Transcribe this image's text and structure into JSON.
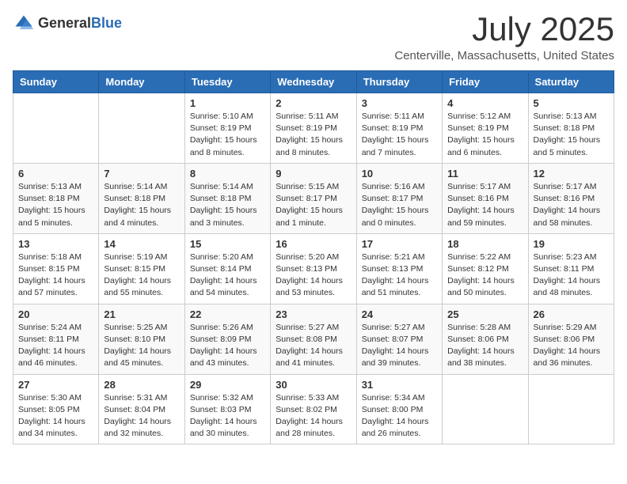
{
  "header": {
    "logo_general": "General",
    "logo_blue": "Blue",
    "month": "July 2025",
    "location": "Centerville, Massachusetts, United States"
  },
  "weekdays": [
    "Sunday",
    "Monday",
    "Tuesday",
    "Wednesday",
    "Thursday",
    "Friday",
    "Saturday"
  ],
  "weeks": [
    [
      null,
      null,
      {
        "day": 1,
        "sunrise": "5:10 AM",
        "sunset": "8:19 PM",
        "daylight": "15 hours and 8 minutes."
      },
      {
        "day": 2,
        "sunrise": "5:11 AM",
        "sunset": "8:19 PM",
        "daylight": "15 hours and 8 minutes."
      },
      {
        "day": 3,
        "sunrise": "5:11 AM",
        "sunset": "8:19 PM",
        "daylight": "15 hours and 7 minutes."
      },
      {
        "day": 4,
        "sunrise": "5:12 AM",
        "sunset": "8:19 PM",
        "daylight": "15 hours and 6 minutes."
      },
      {
        "day": 5,
        "sunrise": "5:13 AM",
        "sunset": "8:18 PM",
        "daylight": "15 hours and 5 minutes."
      }
    ],
    [
      {
        "day": 6,
        "sunrise": "5:13 AM",
        "sunset": "8:18 PM",
        "daylight": "15 hours and 5 minutes."
      },
      {
        "day": 7,
        "sunrise": "5:14 AM",
        "sunset": "8:18 PM",
        "daylight": "15 hours and 4 minutes."
      },
      {
        "day": 8,
        "sunrise": "5:14 AM",
        "sunset": "8:18 PM",
        "daylight": "15 hours and 3 minutes."
      },
      {
        "day": 9,
        "sunrise": "5:15 AM",
        "sunset": "8:17 PM",
        "daylight": "15 hours and 1 minute."
      },
      {
        "day": 10,
        "sunrise": "5:16 AM",
        "sunset": "8:17 PM",
        "daylight": "15 hours and 0 minutes."
      },
      {
        "day": 11,
        "sunrise": "5:17 AM",
        "sunset": "8:16 PM",
        "daylight": "14 hours and 59 minutes."
      },
      {
        "day": 12,
        "sunrise": "5:17 AM",
        "sunset": "8:16 PM",
        "daylight": "14 hours and 58 minutes."
      }
    ],
    [
      {
        "day": 13,
        "sunrise": "5:18 AM",
        "sunset": "8:15 PM",
        "daylight": "14 hours and 57 minutes."
      },
      {
        "day": 14,
        "sunrise": "5:19 AM",
        "sunset": "8:15 PM",
        "daylight": "14 hours and 55 minutes."
      },
      {
        "day": 15,
        "sunrise": "5:20 AM",
        "sunset": "8:14 PM",
        "daylight": "14 hours and 54 minutes."
      },
      {
        "day": 16,
        "sunrise": "5:20 AM",
        "sunset": "8:13 PM",
        "daylight": "14 hours and 53 minutes."
      },
      {
        "day": 17,
        "sunrise": "5:21 AM",
        "sunset": "8:13 PM",
        "daylight": "14 hours and 51 minutes."
      },
      {
        "day": 18,
        "sunrise": "5:22 AM",
        "sunset": "8:12 PM",
        "daylight": "14 hours and 50 minutes."
      },
      {
        "day": 19,
        "sunrise": "5:23 AM",
        "sunset": "8:11 PM",
        "daylight": "14 hours and 48 minutes."
      }
    ],
    [
      {
        "day": 20,
        "sunrise": "5:24 AM",
        "sunset": "8:11 PM",
        "daylight": "14 hours and 46 minutes."
      },
      {
        "day": 21,
        "sunrise": "5:25 AM",
        "sunset": "8:10 PM",
        "daylight": "14 hours and 45 minutes."
      },
      {
        "day": 22,
        "sunrise": "5:26 AM",
        "sunset": "8:09 PM",
        "daylight": "14 hours and 43 minutes."
      },
      {
        "day": 23,
        "sunrise": "5:27 AM",
        "sunset": "8:08 PM",
        "daylight": "14 hours and 41 minutes."
      },
      {
        "day": 24,
        "sunrise": "5:27 AM",
        "sunset": "8:07 PM",
        "daylight": "14 hours and 39 minutes."
      },
      {
        "day": 25,
        "sunrise": "5:28 AM",
        "sunset": "8:06 PM",
        "daylight": "14 hours and 38 minutes."
      },
      {
        "day": 26,
        "sunrise": "5:29 AM",
        "sunset": "8:06 PM",
        "daylight": "14 hours and 36 minutes."
      }
    ],
    [
      {
        "day": 27,
        "sunrise": "5:30 AM",
        "sunset": "8:05 PM",
        "daylight": "14 hours and 34 minutes."
      },
      {
        "day": 28,
        "sunrise": "5:31 AM",
        "sunset": "8:04 PM",
        "daylight": "14 hours and 32 minutes."
      },
      {
        "day": 29,
        "sunrise": "5:32 AM",
        "sunset": "8:03 PM",
        "daylight": "14 hours and 30 minutes."
      },
      {
        "day": 30,
        "sunrise": "5:33 AM",
        "sunset": "8:02 PM",
        "daylight": "14 hours and 28 minutes."
      },
      {
        "day": 31,
        "sunrise": "5:34 AM",
        "sunset": "8:00 PM",
        "daylight": "14 hours and 26 minutes."
      },
      null,
      null
    ]
  ],
  "labels": {
    "sunrise": "Sunrise:",
    "sunset": "Sunset:",
    "daylight": "Daylight:"
  }
}
